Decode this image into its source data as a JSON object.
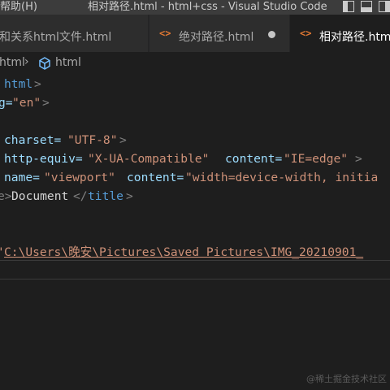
{
  "titlebar": {
    "menu_help": "帮助(H)",
    "window_title": "相对路径.html - html+css - Visual Studio Code"
  },
  "tabs": [
    {
      "label": "和关系html文件.html",
      "active": false
    },
    {
      "label": "绝对路径.html",
      "active": false,
      "dirty": true,
      "icon": "<>"
    },
    {
      "label": "相对路径.html",
      "active": true,
      "icon": "<>"
    }
  ],
  "breadcrumbs": {
    "file": "html",
    "sep": "›",
    "element": "html"
  },
  "code": {
    "l1": {
      "tag": "html",
      "close": ">"
    },
    "l2": {
      "attr": "g=",
      "value": "\"en\"",
      "close": ">"
    },
    "l3": {
      "attr": "charset=",
      "value": "\"UTF-8\"",
      "close": ">"
    },
    "l4": {
      "attr1": "http-equiv=",
      "value1": "\"X-UA-Compatible\"",
      "attr2": "content=",
      "value2": "\"IE=edge\"",
      "close": ">"
    },
    "l5": {
      "attr1": "name=",
      "value1": "\"viewport\"",
      "attr2": "content=",
      "value2": "\"width=device-width, initia"
    },
    "l6": {
      "lead": "e>",
      "text": "Document",
      "close_open": "</",
      "tag": "title",
      "close": ">"
    },
    "l7": {
      "quote": "'",
      "path": "C:\\Users\\晚安\\Pictures\\Saved Pictures\\IMG_20210901_"
    }
  },
  "watermark": "@稀土掘金技术社区",
  "colors": {
    "titlebar": "#3c3c3c",
    "editor_bg": "#1e1e1e",
    "tag": "#569cd6",
    "attribute": "#9cdcfe",
    "string": "#ce9178",
    "html_icon": "#e37933"
  }
}
